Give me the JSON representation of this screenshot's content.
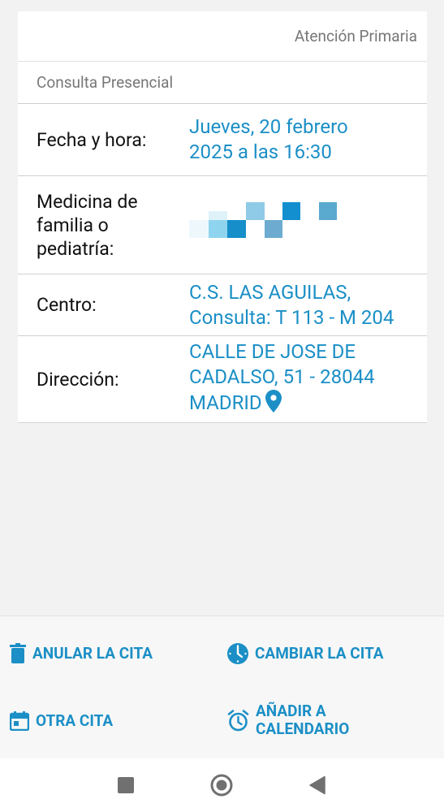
{
  "card": {
    "header": "Atención Primaria",
    "subheader": "Consulta Presencial",
    "rows": {
      "fecha": {
        "label": "Fecha y hora:",
        "value_line1": "Jueves, 20 febrero",
        "value_line2": "2025 a las 16:30"
      },
      "medico": {
        "label_line1": "Medicina de",
        "label_line2": "familia o",
        "label_line3": "pediatría:"
      },
      "centro": {
        "label": "Centro:",
        "value_line1": "C.S. LAS AGUILAS,",
        "value_line2": "Consulta: T 113 - M 204"
      },
      "direccion": {
        "label": "Dirección:",
        "value_line1": "CALLE DE JOSE DE",
        "value_line2": "CADALSO, 51 - 28044",
        "value_line3": "MADRID"
      }
    }
  },
  "actions": {
    "anular": "ANULAR LA CITA",
    "cambiar": "CAMBIAR LA CITA",
    "otra": "OTRA CITA",
    "anadir_line1": "AÑADIR A",
    "anadir_line2": "CALENDARIO"
  },
  "colors": {
    "accent": "#1b8fc6",
    "background": "#f2f2f2",
    "card": "#ffffff"
  },
  "icons": [
    "trash-icon",
    "clock-icon",
    "calendar-icon",
    "alarm-icon",
    "location-pin-icon",
    "nav-recents-icon",
    "nav-home-icon",
    "nav-back-icon"
  ]
}
